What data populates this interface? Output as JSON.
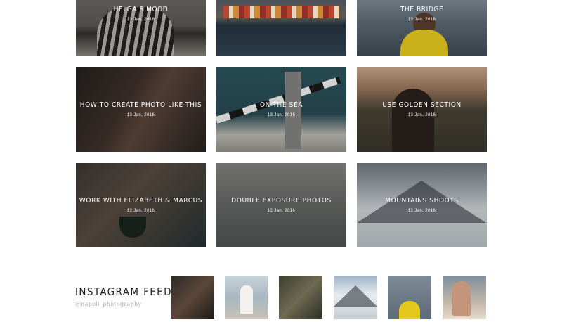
{
  "gallery": {
    "posts": [
      {
        "title": "Helga's Mood",
        "date": "13 Jan, 2016"
      },
      {
        "title": "",
        "date": ""
      },
      {
        "title": "The Bridge",
        "date": "13 Jan, 2016"
      },
      {
        "title": "How to create photo like this",
        "date": "13 Jan, 2016"
      },
      {
        "title": "On the sea",
        "date": "13 Jan, 2016"
      },
      {
        "title": "Use golden section",
        "date": "13 Jan, 2016"
      },
      {
        "title": "Work with Elizabeth & Marcus",
        "date": "13 Jan, 2016"
      },
      {
        "title": "Double exposure photos",
        "date": "13 Jan, 2016"
      },
      {
        "title": "Mountains shoots",
        "date": "13 Jan, 2016"
      }
    ]
  },
  "instagram": {
    "title": "Instagram Feed",
    "handle": "@napoli_photography",
    "thumbs": [
      "photo-1",
      "photo-2",
      "photo-3",
      "photo-4",
      "photo-5",
      "photo-6"
    ]
  },
  "colors": {
    "caption_text": "#ffffff",
    "heading_text": "#222222",
    "handle_text": "#b0b0b0",
    "accent_yellow": "#e5c81d"
  }
}
